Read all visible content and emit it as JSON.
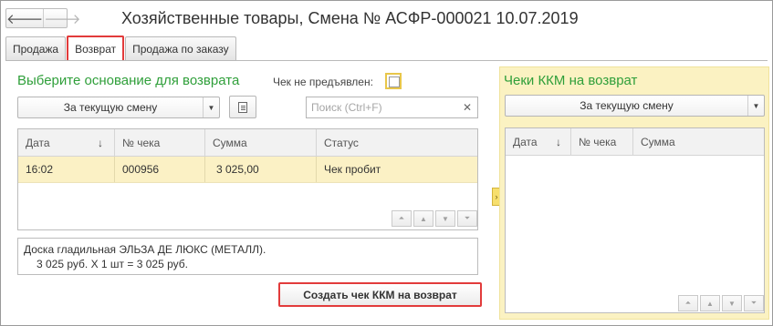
{
  "title": "Хозяйственные товары, Смена № АСФР-000021  10.07.2019",
  "nav": {
    "back_glyph": "🡐",
    "forward_glyph": "🡒"
  },
  "tabs": [
    {
      "label": "Продажа"
    },
    {
      "label": "Возврат"
    },
    {
      "label": "Продажа по заказу"
    }
  ],
  "left": {
    "section_title": "Выберите основание для возврата",
    "check_label": "Чек не предъявлен:",
    "check_checked": false,
    "shift_select": "За текущую смену",
    "search_placeholder": "Поиск (Ctrl+F)",
    "columns": [
      "Дата",
      "№ чека",
      "Сумма",
      "Статус"
    ],
    "rows": [
      {
        "date": "16:02",
        "receipt": "000956",
        "amount": "3 025,00",
        "status": "Чек пробит"
      }
    ],
    "details_line1": "Доска гладильная  ЭЛЬЗА ДЕ ЛЮКС (МЕТАЛЛ).",
    "details_line2": "3 025 руб. X 1 шт = 3 025 руб.",
    "create_button": "Создать чек ККМ на возврат"
  },
  "right": {
    "section_title": "Чеки ККМ на возврат",
    "shift_select": "За текущую смену",
    "columns": [
      "Дата",
      "№ чека",
      "Сумма"
    ]
  },
  "colors": {
    "accent_green": "#2f9f3a",
    "highlight_red": "#e23b3b",
    "row_yellow": "#fbf1c5"
  }
}
